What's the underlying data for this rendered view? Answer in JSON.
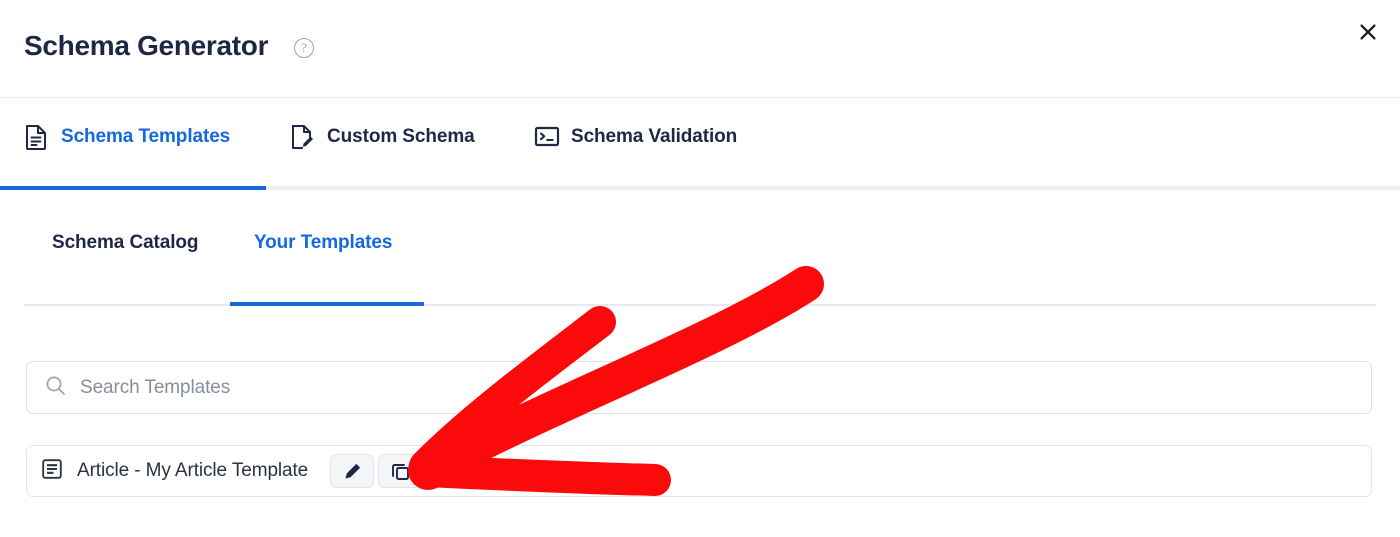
{
  "dialog": {
    "title": "Schema Generator",
    "help_icon": "help-circle-icon",
    "help_label": "?",
    "close_icon": "close-icon"
  },
  "tabs": [
    {
      "label": "Schema Templates",
      "icon": "document-lines-icon",
      "active": true
    },
    {
      "label": "Custom Schema",
      "icon": "document-pencil-icon",
      "active": false
    },
    {
      "label": "Schema Validation",
      "icon": "terminal-icon",
      "active": false
    }
  ],
  "subtabs": [
    {
      "label": "Schema Catalog",
      "active": false
    },
    {
      "label": "Your Templates",
      "active": true
    }
  ],
  "search": {
    "placeholder": "Search Templates",
    "value": "",
    "icon": "search-icon"
  },
  "templates": [
    {
      "icon": "article-icon",
      "name": "Article - My Article Template",
      "actions": [
        {
          "icon": "pencil-icon",
          "name": "edit-template-button"
        },
        {
          "icon": "duplicate-icon",
          "name": "secondary-template-button"
        }
      ]
    }
  ],
  "annotation": {
    "type": "arrow",
    "color": "#fa0a0a",
    "points_to": "secondary-template-button"
  },
  "colors": {
    "accent": "#1568e0",
    "title": "#1f2746",
    "text": "#2b3243",
    "muted": "#868e9c",
    "border": "#e3e5ea",
    "annotation": "#fa0a0a"
  }
}
